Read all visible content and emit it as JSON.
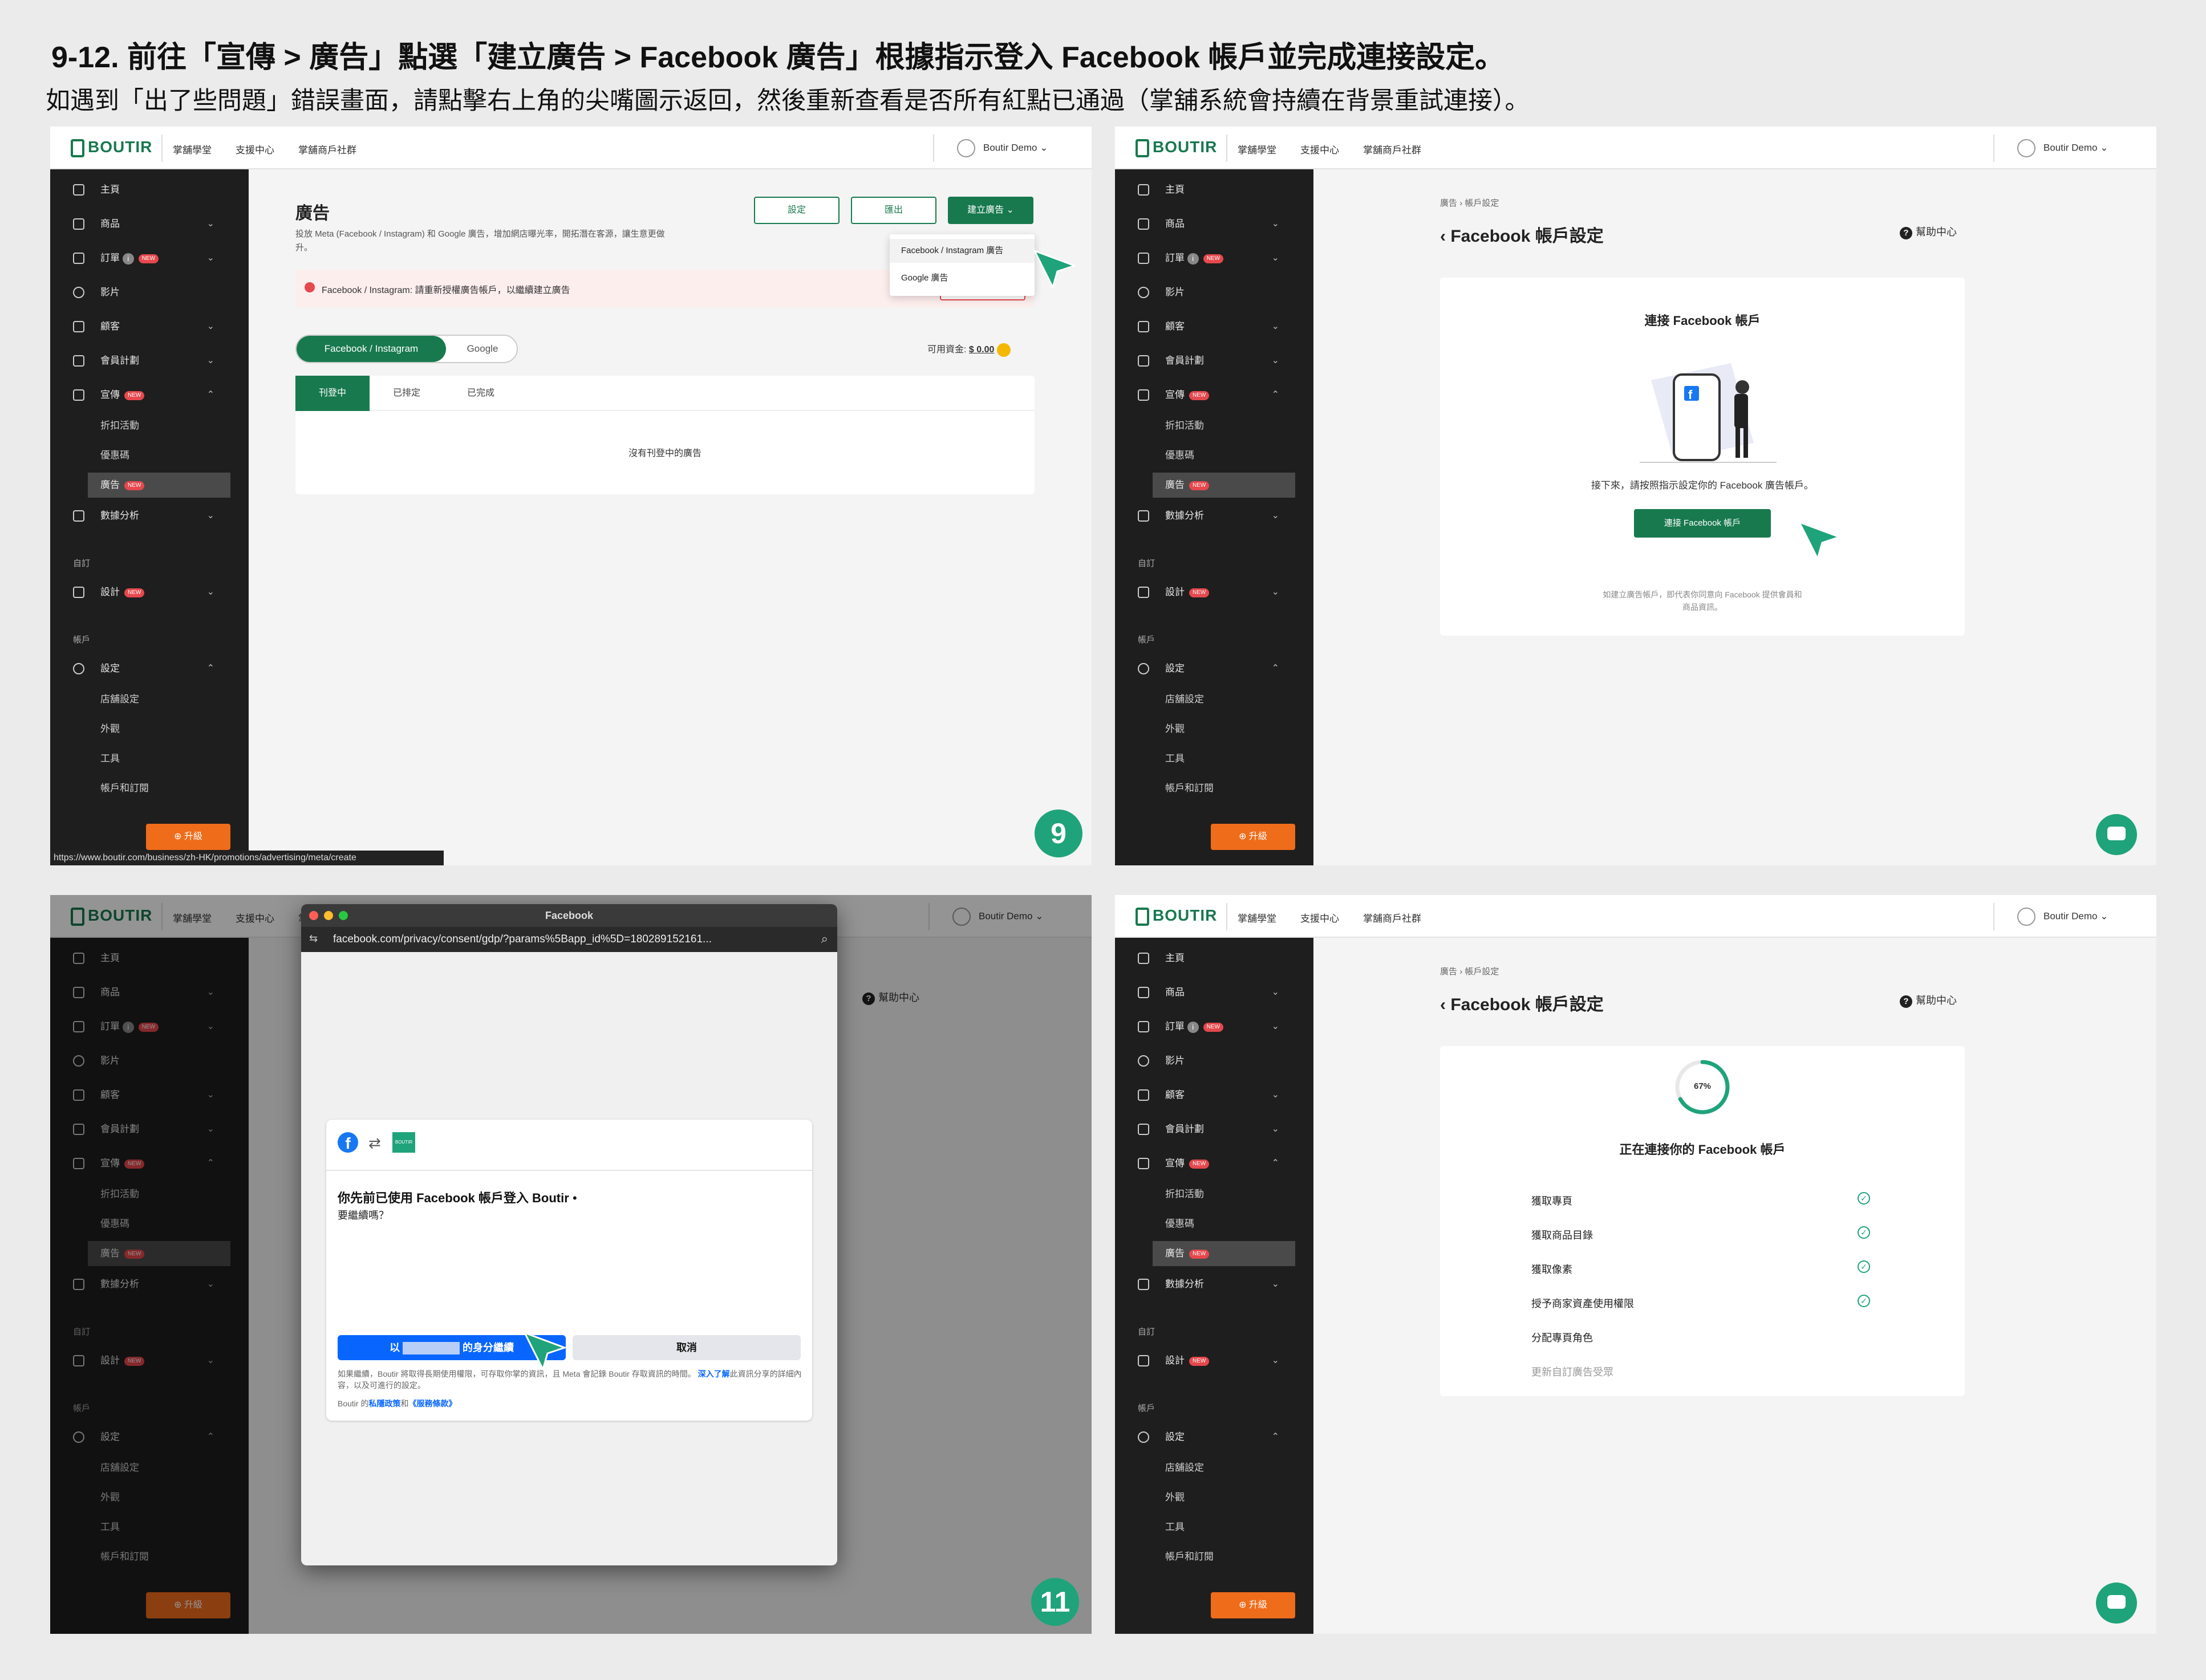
{
  "heading": "9-12. 前往「宣傳 > 廣告」點選「建立廣告 > Facebook 廣告」根據指示登入 Facebook 帳戶並完成連接設定。",
  "subheading": "如遇到「出了些問題」錯誤畫面，請點擊右上角的尖嘴圖示返回，然後重新查看是否所有紅點已通過（掌舖系統會持續在背景重試連接）。",
  "app": {
    "logo": "BOUTIR",
    "nav": [
      "掌舖學堂",
      "支援中心",
      "掌舖商戶社群"
    ],
    "user": "Boutir Demo",
    "user_chevron": "⌄"
  },
  "sidebar": {
    "items": [
      "主頁",
      "商品",
      "訂單",
      "影片",
      "顧客",
      "會員計劃",
      "宣傳",
      "折扣活動",
      "優惠碼",
      "廣告",
      "數據分析",
      "設計",
      "設定",
      "店舖設定",
      "外觀",
      "工具",
      "帳戶和訂閱"
    ],
    "groups": [
      "自訂",
      "帳戶"
    ],
    "badge": "NEW",
    "info": "i",
    "upgrade": "升級",
    "chev_down": "⌄",
    "chev_up": "⌃"
  },
  "s9": {
    "title": "廣告",
    "desc": "投放 Meta (Facebook / Instagram) 和 Google 廣告，增加網店曝光率，開拓潛在客源，讓生意更做",
    "desc2": "升。",
    "btn_settings": "設定",
    "btn_export": "匯出",
    "btn_create": "建立廣告",
    "dropdown": [
      "Facebook / Instagram 廣告",
      "Google 廣告"
    ],
    "alert": "Facebook / Instagram: 請重新授權廣告帳戶，以繼續建立廣告",
    "alert_btn": "重新授權",
    "seg": [
      "Facebook / Instagram",
      "Google"
    ],
    "funds_label": "可用資金:",
    "funds_value": "$ 0.00",
    "tabs": [
      "刊登中",
      "已排定",
      "已完成"
    ],
    "empty": "沒有刊登中的廣告",
    "url": "https://www.boutir.com/business/zh-HK/promotions/advertising/meta/create",
    "step": "9"
  },
  "s10": {
    "crumb": [
      "廣告",
      "帳戶設定"
    ],
    "crumb_sep": "›",
    "back": "‹",
    "title": "Facebook 帳戶設定",
    "help": "幫助中心",
    "help_q": "?",
    "card_title": "連接 Facebook 帳戶",
    "hint": "接下來，請按照指示設定你的 Facebook 廣告帳戶。",
    "button": "連接 Facebook 帳戶",
    "fine1": "如建立廣告帳戶，即代表你同意向 Facebook 提供會員和",
    "fine2": "商品資訊。",
    "fb": "f"
  },
  "s11": {
    "window_title": "Facebook",
    "url": "facebook.com/privacy/consent/gdp/?params%5Bapp_id%5D=180289152161...",
    "fb_icon": "f",
    "brand_mini": "BOUTIR",
    "sync_glyph": "⇄",
    "search_glyph": "⌕",
    "url_glyph": "⇆",
    "prompt": "你先前已使用 Facebook 帳戶登入 Boutir",
    "ask": "要繼續嗎？",
    "btn_continue_pre": "以",
    "btn_continue_post": "的身分繼續",
    "btn_cancel": "取消",
    "legal1": "如果繼續，Boutir 將取得長期使用權限，可存取你",
    "legal1b": "掌的資訊，且 Meta 會記錄 Boutir 存取資訊的時間。",
    "legal_link": "深入了",
    "legal2a": "解",
    "legal2": "此資訊分享的詳細內容，以及可進行的設定。",
    "privacy_pre": "Boutir 的",
    "privacy_link": "私隱政策",
    "privacy_mid": "和",
    "terms_link": "《服務條款》",
    "dot": "•",
    "step": "11",
    "help": "幫助中心"
  },
  "s12": {
    "crumb": [
      "廣告",
      "帳戶設定"
    ],
    "crumb_sep": "›",
    "back": "‹",
    "title": "Facebook 帳戶設定",
    "help": "幫助中心",
    "help_q": "?",
    "progress_label": "67%",
    "progress": 0.67,
    "card_title": "正在連接你的 Facebook 帳戶",
    "steps": [
      "獲取專頁",
      "獲取商品目錄",
      "獲取像素",
      "授予商家資產使用權限",
      "分配專頁角色",
      "更新自訂廣告受眾"
    ],
    "done": [
      true,
      true,
      true,
      true,
      false,
      false
    ],
    "check": "✓"
  },
  "colors": {
    "brand": "#18794e",
    "accent": "#1fa37a",
    "upgrade": "#ef6c1b",
    "fb": "#1877f2",
    "alert_bg": "#fdeeee",
    "alert_red": "#e5484d"
  }
}
